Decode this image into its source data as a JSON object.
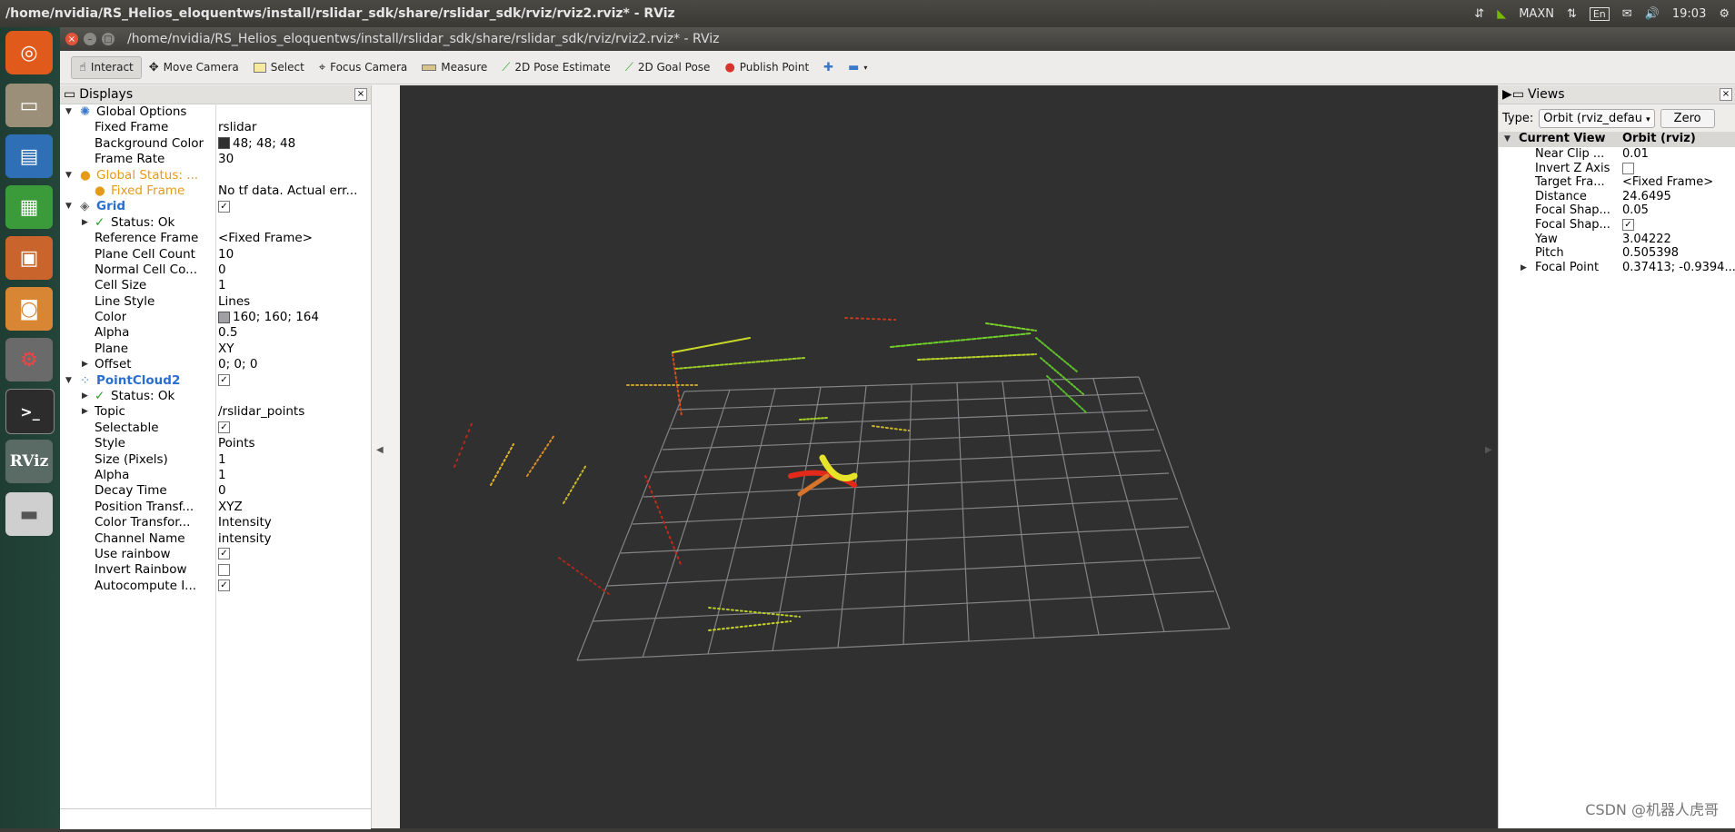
{
  "system_bar": {
    "title": "/home/nvidia/RS_Helios_eloquentws/install/rslidar_sdk/share/rslidar_sdk/rviz/rviz2.rviz* - RViz",
    "power_mode": "MAXN",
    "keyboard": "En",
    "time": "19:03"
  },
  "window": {
    "title": "/home/nvidia/RS_Helios_eloquentws/install/rslidar_sdk/share/rslidar_sdk/rviz/rviz2.rviz* - RViz"
  },
  "launcher": {
    "rviz_label": "RViz"
  },
  "toolbar": {
    "interact": "Interact",
    "move_camera": "Move Camera",
    "select": "Select",
    "focus_camera": "Focus Camera",
    "measure": "Measure",
    "pose_estimate": "2D Pose Estimate",
    "goal_pose": "2D Goal Pose",
    "publish_point": "Publish Point"
  },
  "displays": {
    "header": "Displays",
    "rows": [
      {
        "k": "Global Options",
        "v": ""
      },
      {
        "k": "Fixed Frame",
        "v": "rslidar"
      },
      {
        "k": "Background Color",
        "v": "48; 48; 48"
      },
      {
        "k": "Frame Rate",
        "v": "30"
      },
      {
        "k": "Global Status: ...",
        "v": ""
      },
      {
        "k": "Fixed Frame",
        "v": "No tf data.  Actual err..."
      },
      {
        "k": "Grid",
        "v": ""
      },
      {
        "k": "Status: Ok",
        "v": ""
      },
      {
        "k": "Reference Frame",
        "v": "<Fixed Frame>"
      },
      {
        "k": "Plane Cell Count",
        "v": "10"
      },
      {
        "k": "Normal Cell Co...",
        "v": "0"
      },
      {
        "k": "Cell Size",
        "v": "1"
      },
      {
        "k": "Line Style",
        "v": "Lines"
      },
      {
        "k": "Color",
        "v": "160; 160; 164"
      },
      {
        "k": "Alpha",
        "v": "0.5"
      },
      {
        "k": "Plane",
        "v": "XY"
      },
      {
        "k": "Offset",
        "v": "0; 0; 0"
      },
      {
        "k": "PointCloud2",
        "v": ""
      },
      {
        "k": "Status: Ok",
        "v": ""
      },
      {
        "k": "Topic",
        "v": "/rslidar_points"
      },
      {
        "k": "Selectable",
        "v": ""
      },
      {
        "k": "Style",
        "v": "Points"
      },
      {
        "k": "Size (Pixels)",
        "v": "1"
      },
      {
        "k": "Alpha",
        "v": "1"
      },
      {
        "k": "Decay Time",
        "v": "0"
      },
      {
        "k": "Position Transf...",
        "v": "XYZ"
      },
      {
        "k": "Color Transfor...",
        "v": "Intensity"
      },
      {
        "k": "Channel Name",
        "v": "intensity"
      },
      {
        "k": "Use rainbow",
        "v": ""
      },
      {
        "k": "Invert Rainbow",
        "v": ""
      },
      {
        "k": "Autocompute I...",
        "v": ""
      }
    ]
  },
  "views": {
    "header": "Views",
    "type_label": "Type:",
    "type_value": "Orbit (rviz_defau",
    "zero_button": "Zero",
    "current_view": "Current View",
    "current_view_type": "Orbit (rviz)",
    "rows": [
      {
        "k": "Near Clip ...",
        "v": "0.01"
      },
      {
        "k": "Invert Z Axis",
        "v": ""
      },
      {
        "k": "Target Fra...",
        "v": "<Fixed Frame>"
      },
      {
        "k": "Distance",
        "v": "24.6495"
      },
      {
        "k": "Focal Shap...",
        "v": "0.05"
      },
      {
        "k": "Focal Shap...",
        "v": ""
      },
      {
        "k": "Yaw",
        "v": "3.04222"
      },
      {
        "k": "Pitch",
        "v": "0.505398"
      },
      {
        "k": "Focal Point",
        "v": "0.37413; -0.9394..."
      }
    ]
  },
  "watermark": "CSDN @机器人虎哥",
  "colors": {
    "viewport_bg": "#303030",
    "grid": "#a0a0a4",
    "launcher": "#24453a"
  }
}
